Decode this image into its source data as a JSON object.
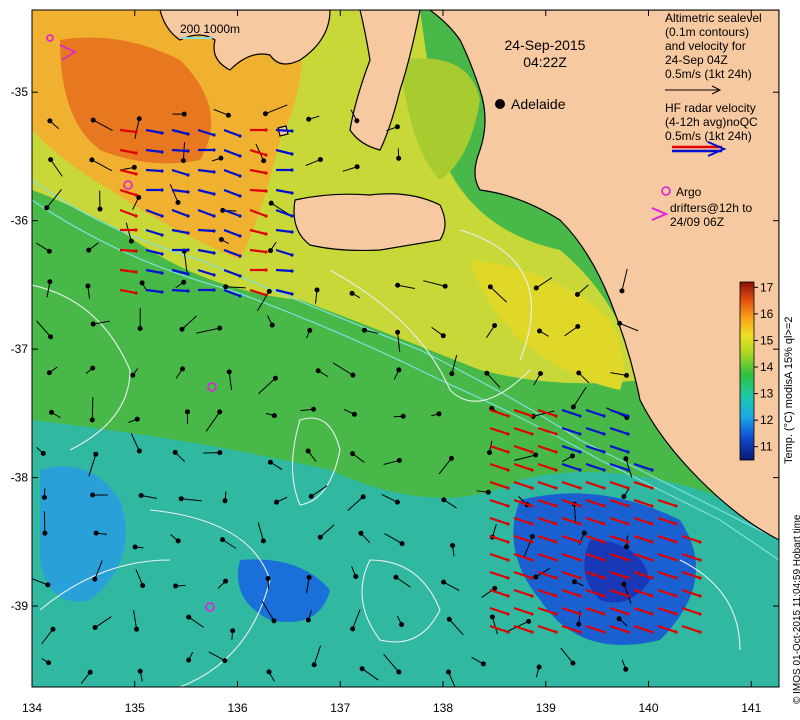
{
  "map": {
    "date": "24-Sep-2015",
    "time": "04:22Z",
    "place_label": "Adelaide",
    "x_ticks": [
      "134",
      "135",
      "136",
      "137",
      "138",
      "139",
      "140",
      "141"
    ],
    "y_ticks": [
      "-35",
      "-36",
      "-37",
      "-38",
      "-39"
    ],
    "depth_contours_label": "200  1000m",
    "colors": {
      "land": "#f7c9a0",
      "coast": "#000000",
      "depth_contour": "#7fe0e0",
      "sealevel_contour": "#e8f0f0",
      "hf_red": "#e00000",
      "hf_blue": "#0010d0",
      "argo": "#e020e0"
    }
  },
  "legend": {
    "altimetry_lines": [
      "Altimetric sealevel",
      "(0.1m contours)",
      "and velocity for",
      "24-Sep 04Z",
      "0.5m/s (1kt 24h)"
    ],
    "hf_lines": [
      "HF radar velocity",
      "(4-12h avg)noQC",
      "0.5m/s (1kt 24h)"
    ],
    "argo_lines": [
      "Argo",
      "drifters@12h to",
      "24/09 06Z"
    ],
    "colorbar_title": "Temp. (°C) modisA 15% ql>=2",
    "colorbar_ticks": [
      "11",
      "12",
      "13",
      "14",
      "15",
      "16",
      "17"
    ],
    "colorbar_range": [
      10.5,
      17.2
    ]
  },
  "credit": "© IMOS 01-Oct-2015 11:04:59 Hobart time"
}
